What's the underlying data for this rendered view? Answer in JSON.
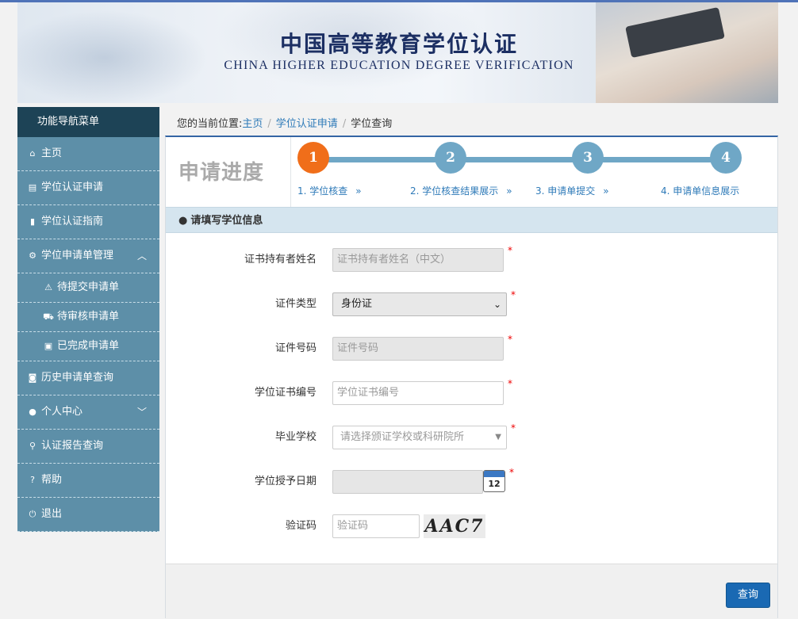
{
  "banner": {
    "title": "中国高等教育学位认证",
    "subtitle": "CHINA HIGHER EDUCATION DEGREE VERIFICATION"
  },
  "sidebar": {
    "header": "功能导航菜单",
    "items": [
      {
        "label": "主页",
        "icon": "home-icon"
      },
      {
        "label": "学位认证申请",
        "icon": "document-icon"
      },
      {
        "label": "学位认证指南",
        "icon": "bookmark-icon"
      },
      {
        "label": "学位申请单管理",
        "icon": "gear-icon",
        "expanded": true,
        "children": [
          {
            "label": "待提交申请单",
            "icon": "warning-icon"
          },
          {
            "label": "待审核申请单",
            "icon": "cart-icon"
          },
          {
            "label": "已完成申请单",
            "icon": "briefcase-icon"
          }
        ]
      },
      {
        "label": "历史申请单查询",
        "icon": "camera-icon"
      },
      {
        "label": "个人中心",
        "icon": "user-icon",
        "expanded": false
      },
      {
        "label": "认证报告查询",
        "icon": "search-icon"
      },
      {
        "label": "帮助",
        "icon": "help-icon"
      },
      {
        "label": "退出",
        "icon": "power-icon"
      }
    ]
  },
  "breadcrumb": {
    "prefix": "您的当前位置:",
    "items": [
      "主页",
      "学位认证申请",
      "学位查询"
    ],
    "separator": "/"
  },
  "progress": {
    "title": "申请进度",
    "steps": [
      {
        "number": "1",
        "label": "1. 学位核查",
        "active": true
      },
      {
        "number": "2",
        "label": "2. 学位核查结果展示",
        "active": false
      },
      {
        "number": "3",
        "label": "3. 申请单提交",
        "active": false
      },
      {
        "number": "4",
        "label": "4. 申请单信息展示",
        "active": false
      }
    ],
    "arrow": "»"
  },
  "form": {
    "section_title": "请填写学位信息",
    "fields": [
      {
        "label": "证书持有者姓名",
        "placeholder": "证书持有者姓名（中文）",
        "value": ""
      },
      {
        "label": "证件类型",
        "value": "身份证"
      },
      {
        "label": "证件号码",
        "placeholder": "证件号码",
        "value": ""
      },
      {
        "label": "学位证书编号",
        "placeholder": "学位证书编号",
        "value": ""
      },
      {
        "label": "毕业学校",
        "placeholder": "请选择颁证学校或科研院所",
        "value": ""
      },
      {
        "label": "学位授予日期",
        "value": "",
        "calendar_day": "12"
      },
      {
        "label": "验证码",
        "placeholder": "验证码",
        "value": "",
        "captcha_text": "AAC7"
      }
    ],
    "required_mark": "*",
    "submit_label": "查询"
  },
  "colors": {
    "sidebar_header": "#1d4356",
    "sidebar_item": "#5d8fa8",
    "step_active": "#f06e1a",
    "step_inactive": "#6fa7c6",
    "link": "#2e7ab8",
    "primary_button": "#1a69b3",
    "required": "#ee0000"
  }
}
